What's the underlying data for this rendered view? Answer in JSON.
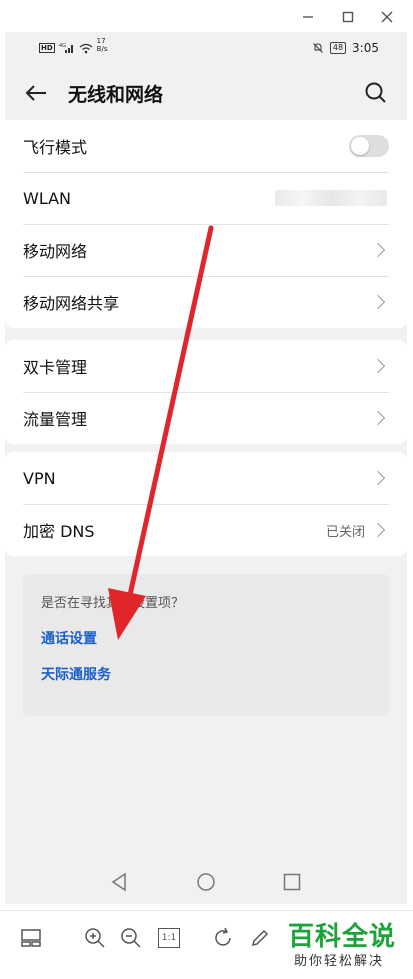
{
  "window_controls": {
    "minimize": "—",
    "maximize": "☐",
    "close": "✕"
  },
  "status_bar": {
    "left_icons": [
      "hd-icon",
      "signal-4g-icon",
      "wifi-icon"
    ],
    "speed_value": "17",
    "speed_unit": "B/s",
    "battery": "48",
    "time": "3:05"
  },
  "header": {
    "title": "无线和网络",
    "back_icon": "arrow-left-icon",
    "search_icon": "search-icon"
  },
  "groups": [
    {
      "rows": [
        {
          "label": "飞行模式",
          "control": "toggle",
          "toggle_on": false
        },
        {
          "label": "WLAN",
          "control": "blurred"
        },
        {
          "label": "移动网络",
          "control": "chevron"
        },
        {
          "label": "移动网络共享",
          "control": "chevron"
        }
      ]
    },
    {
      "rows": [
        {
          "label": "双卡管理",
          "control": "chevron"
        },
        {
          "label": "流量管理",
          "control": "chevron"
        }
      ]
    },
    {
      "rows": [
        {
          "label": "VPN",
          "control": "chevron"
        },
        {
          "label": "加密 DNS",
          "control": "chevron",
          "value": "已关闭"
        }
      ]
    }
  ],
  "suggestion": {
    "question": "是否在寻找其他设置项？",
    "links": [
      "通话设置",
      "天际通服务"
    ]
  },
  "nav_icons": [
    "back-triangle-icon",
    "home-circle-icon",
    "recents-square-icon"
  ],
  "toolbar_icons": [
    "layout-icon",
    "zoom-in-icon",
    "zoom-out-icon",
    "actual-size-icon",
    "rotate-icon",
    "edit-pencil-icon"
  ],
  "toolbar": {
    "actual_size_label": "1:1"
  },
  "watermark": {
    "title": "百科全说",
    "subtitle": "助你轻松解决"
  },
  "colors": {
    "link": "#1a5fc8",
    "annotation_arrow": "#e0262b",
    "watermark_green": "#1fa23a"
  }
}
